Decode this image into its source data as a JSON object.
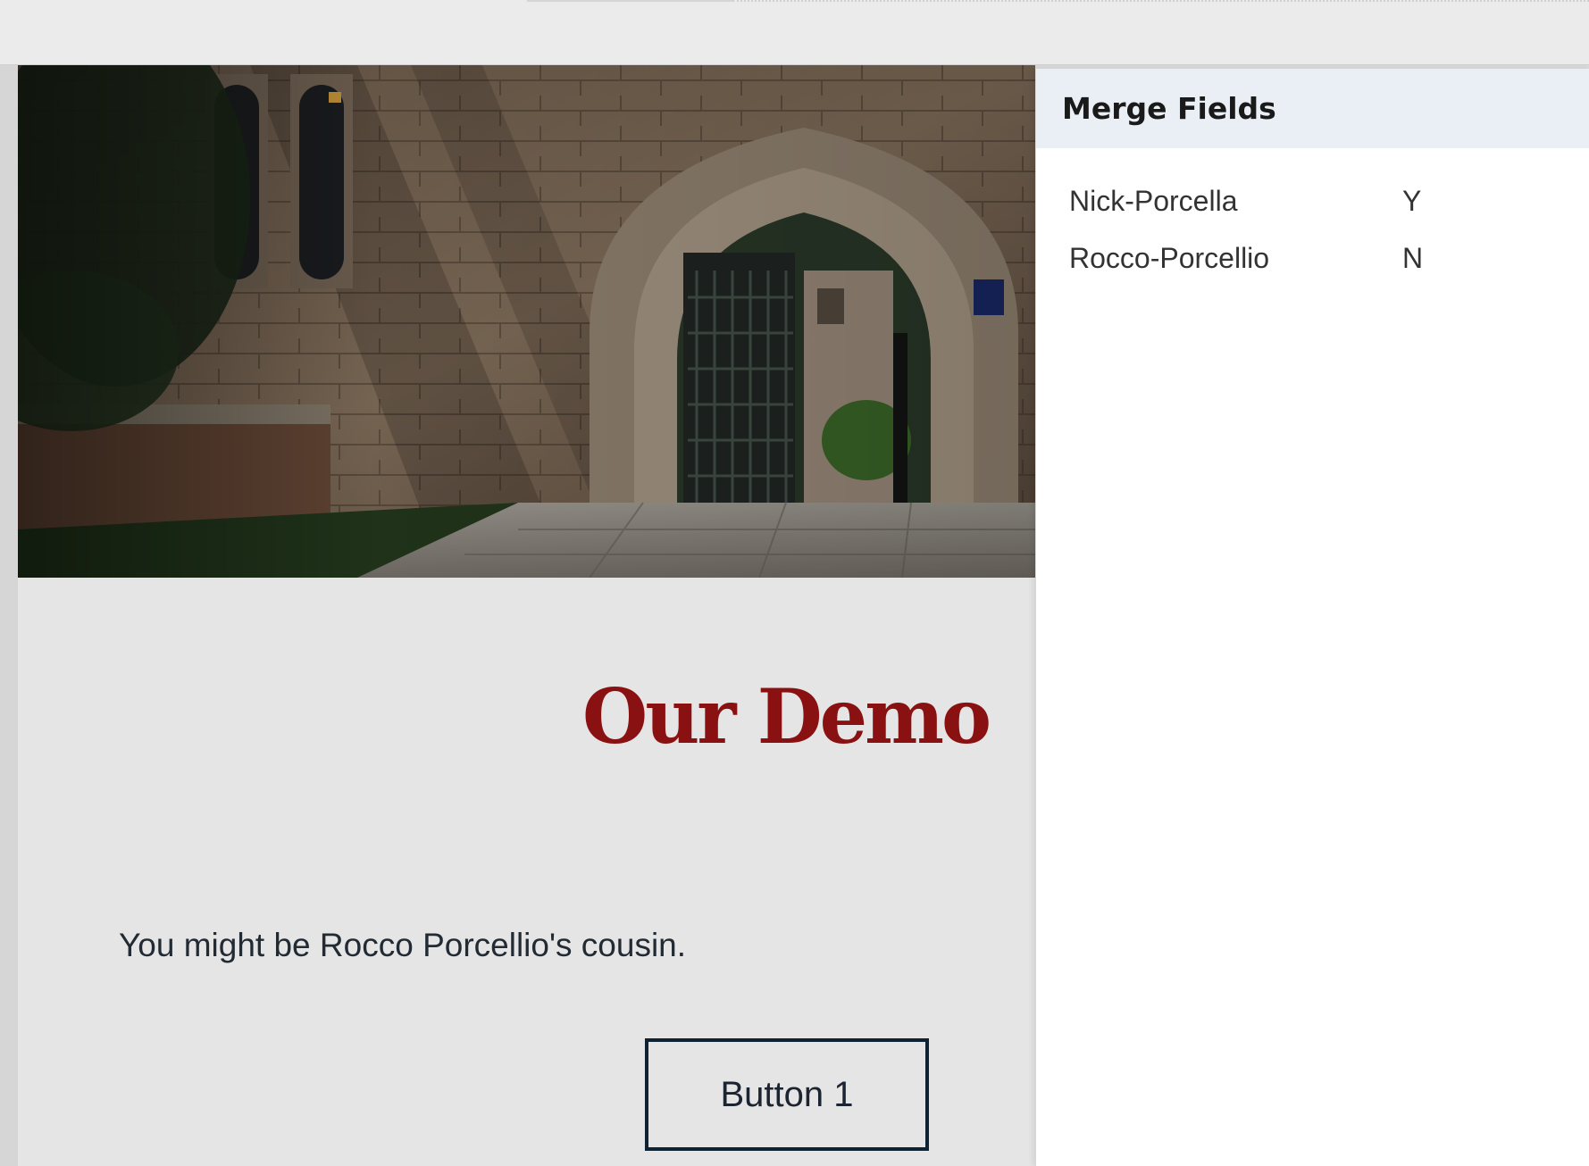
{
  "canvas": {
    "headline": "Our Demo",
    "body_text": "You might be Rocco Porcellio's cousin.",
    "button_label": "Button 1",
    "headline_color": "#8a1111",
    "button_border_color": "#0f2233"
  },
  "merge_panel": {
    "title": "Merge Fields",
    "fields": [
      {
        "name": "Nick-Porcella",
        "value": "Y"
      },
      {
        "name": "Rocco-Porcellio",
        "value": "N"
      }
    ]
  }
}
